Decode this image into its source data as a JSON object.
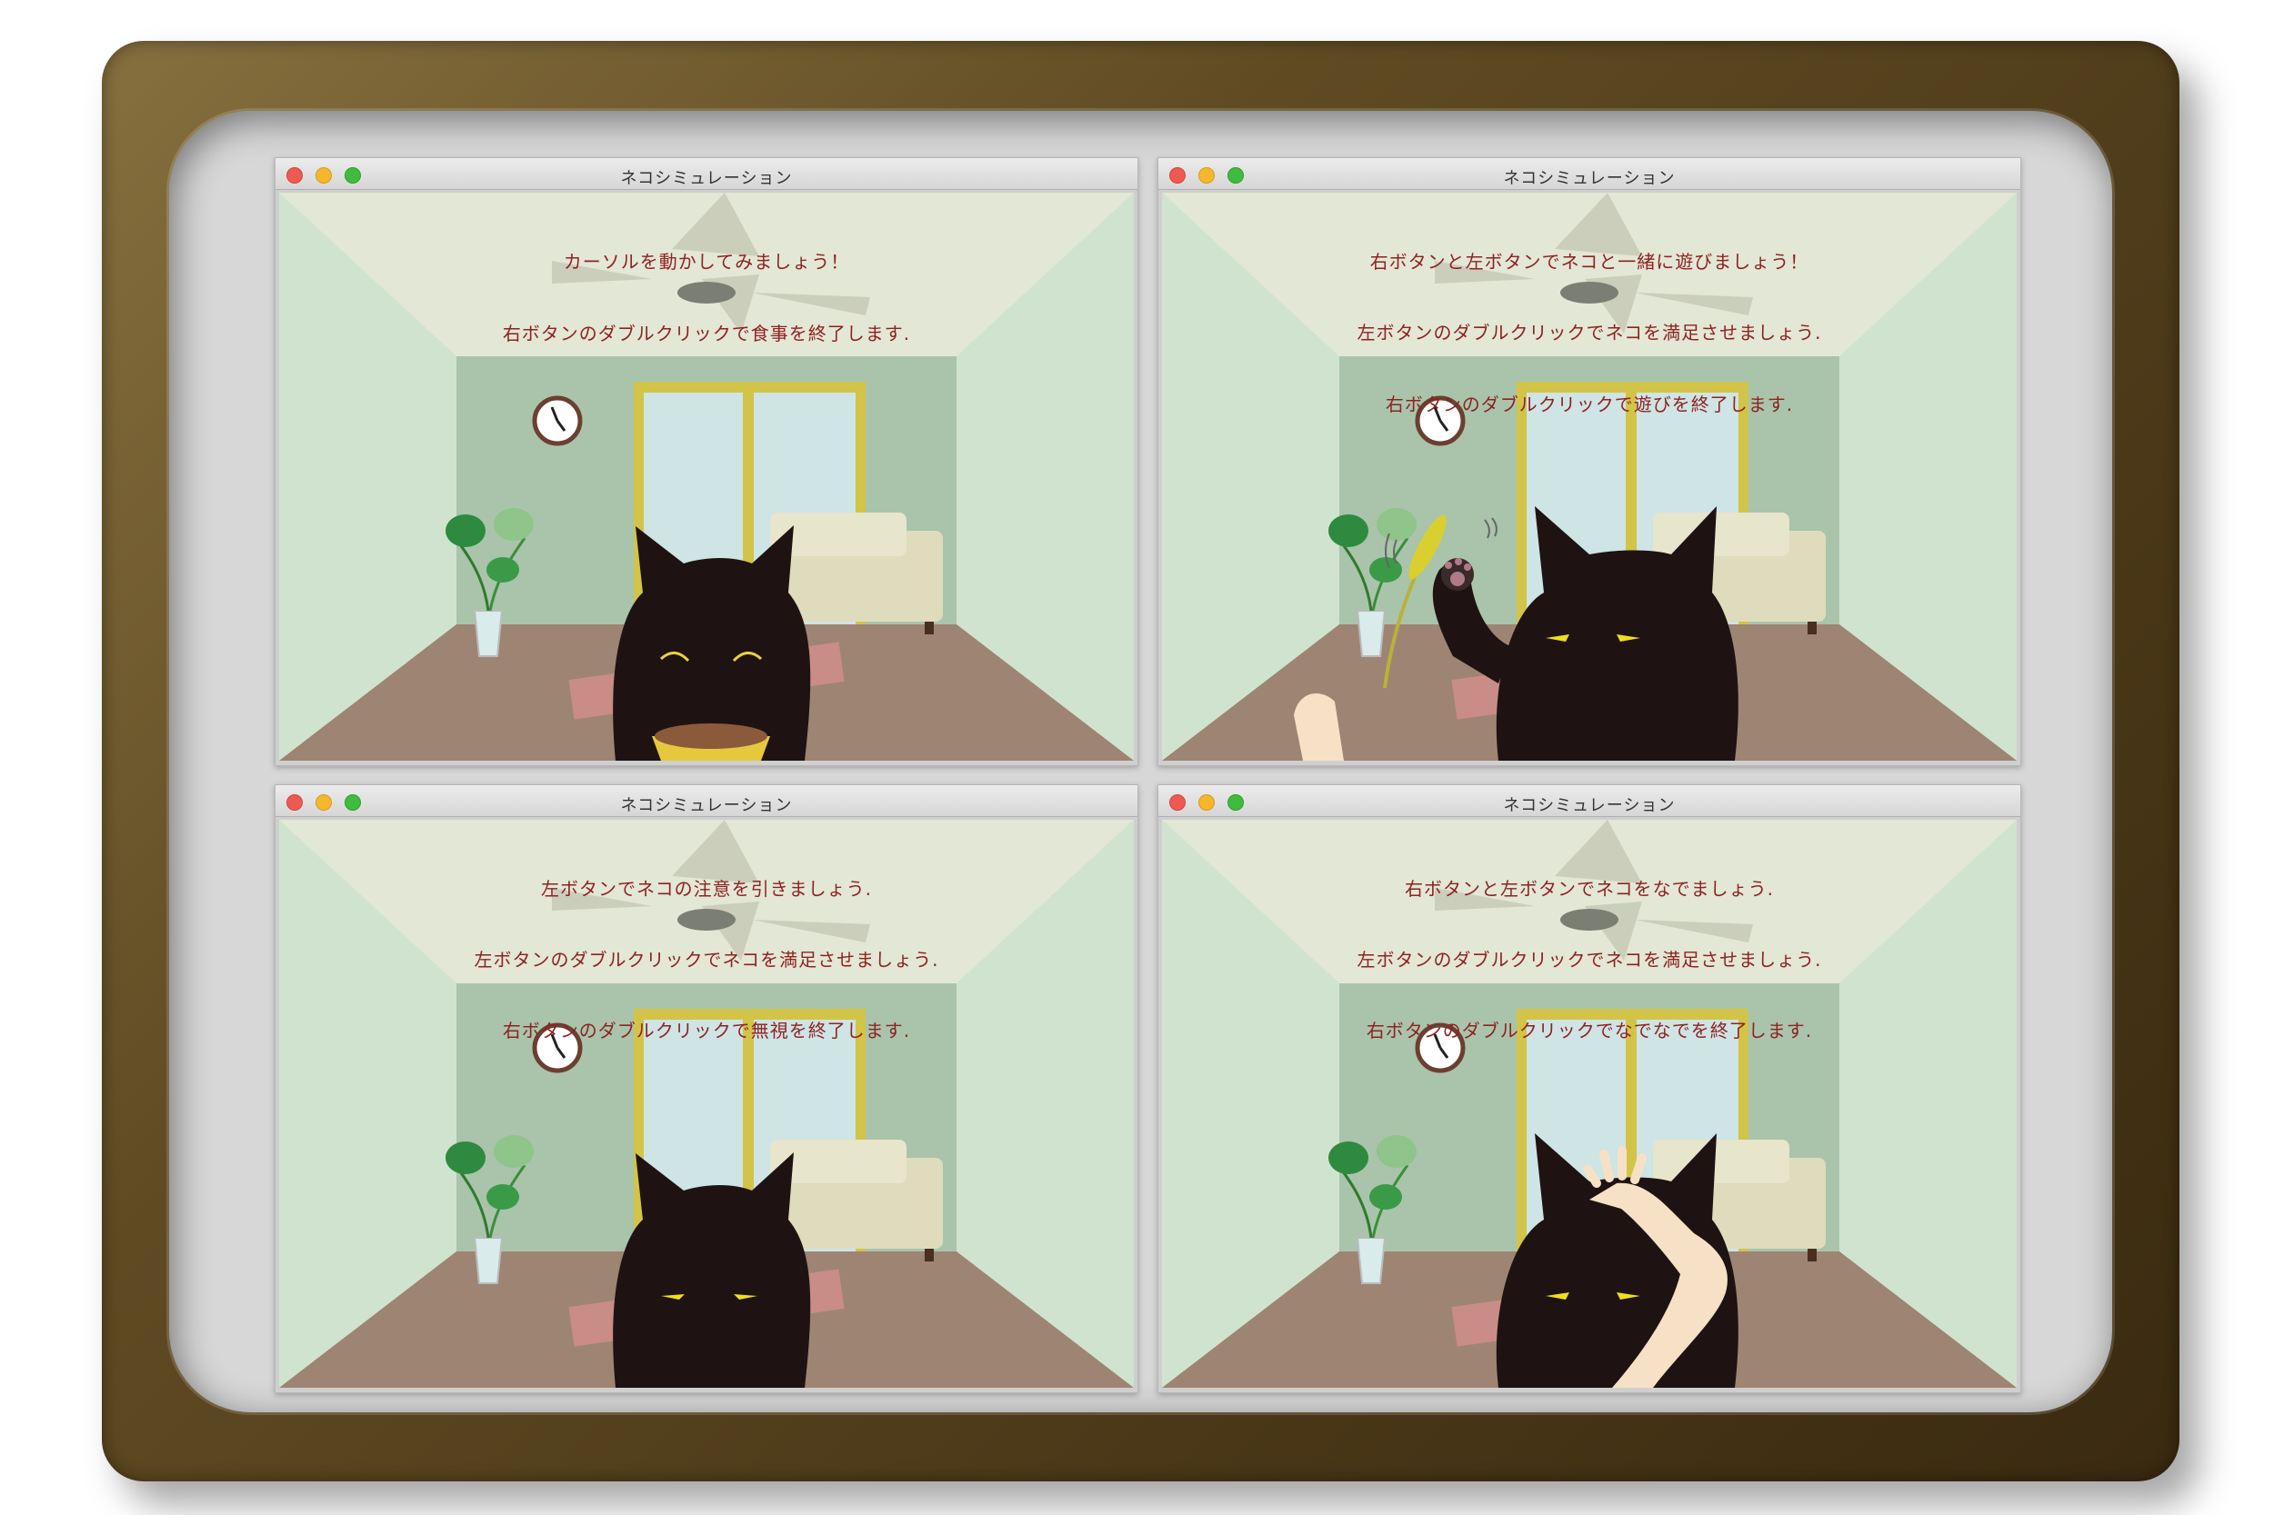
{
  "windows": [
    {
      "title": "ネコシミュレーション",
      "messages": [
        "カーソルを動かしてみましょう！",
        "右ボタンのダブルクリックで食事を終了します."
      ]
    },
    {
      "title": "ネコシミュレーション",
      "messages": [
        "右ボタンと左ボタンでネコと一緒に遊びましょう！",
        "左ボタンのダブルクリックでネコを満足させましょう.",
        "右ボタンのダブルクリックで遊びを終了します."
      ]
    },
    {
      "title": "ネコシミュレーション",
      "messages": [
        "左ボタンでネコの注意を引きましょう.",
        "左ボタンのダブルクリックでネコを満足させましょう.",
        "右ボタンのダブルクリックで無視を終了します."
      ]
    },
    {
      "title": "ネコシミュレーション",
      "messages": [
        "右ボタンと左ボタンでネコをなでましょう.",
        "左ボタンのダブルクリックでネコを満足させましょう.",
        "右ボタンのダブルクリックでなでなでを終了します."
      ]
    }
  ],
  "colors": {
    "frame": "#5f4a22",
    "cat": "#1e1312",
    "message_text": "#8e2222",
    "window_frame": "#d8c84a"
  }
}
